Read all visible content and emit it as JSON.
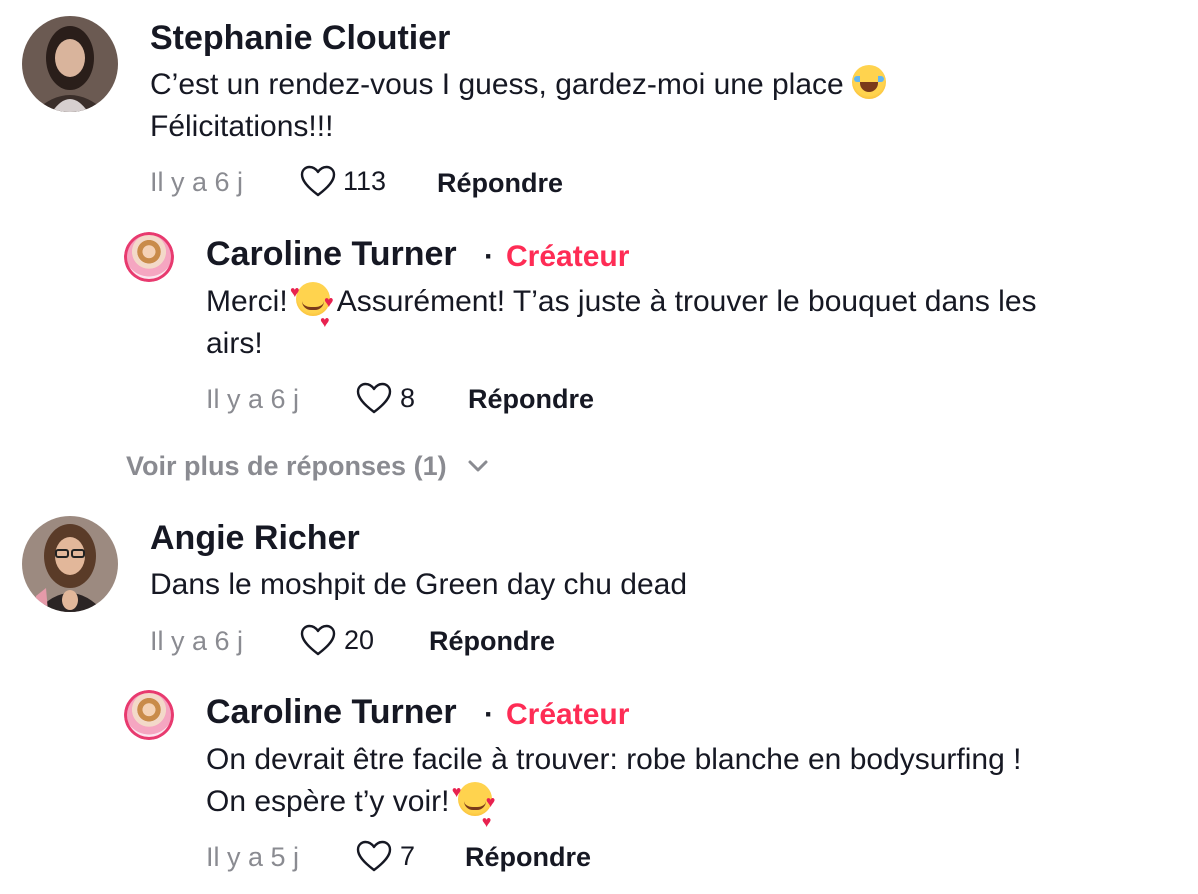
{
  "comments": [
    {
      "username": "Stephanie Cloutier",
      "text_line1": "C’est un rendez-vous I guess, gardez-moi une place",
      "text_line1_emoji": "face-with-tears-of-joy-emoji",
      "text_line2": "Félicitations!!!",
      "time": "Il y a 6 j",
      "likes": "113",
      "reply_label": "Répondre",
      "reply": {
        "username": "Caroline Turner",
        "separator": "·",
        "creator_tag": "Créateur",
        "text_line1_prefix": "Merci!",
        "text_line1_emoji": "smiling-face-with-hearts-emoji",
        "text_line1_suffix": "Assurément! T’as juste à trouver le bouquet dans les",
        "text_line2": "airs!",
        "time": "Il y a 6 j",
        "likes": "8",
        "reply_label": "Répondre"
      },
      "more_replies": "Voir plus de réponses (1)"
    },
    {
      "username": "Angie Richer",
      "text_line1": "Dans le moshpit de Green day chu dead",
      "time": "Il y a 6 j",
      "likes": "20",
      "reply_label": "Répondre",
      "reply": {
        "username": "Caroline Turner",
        "separator": "·",
        "creator_tag": "Créateur",
        "text_line1": "On devrait être facile à trouver: robe blanche en bodysurfing !",
        "text_line2": "On espère t’y voir!",
        "text_line2_emoji": "smiling-face-with-hearts-emoji",
        "time": "Il y a 5 j",
        "likes": "7",
        "reply_label": "Répondre"
      }
    }
  ],
  "colors": {
    "creator_tag": "#fe2c55",
    "meta_gray": "#8a8b91",
    "text": "#161823"
  }
}
